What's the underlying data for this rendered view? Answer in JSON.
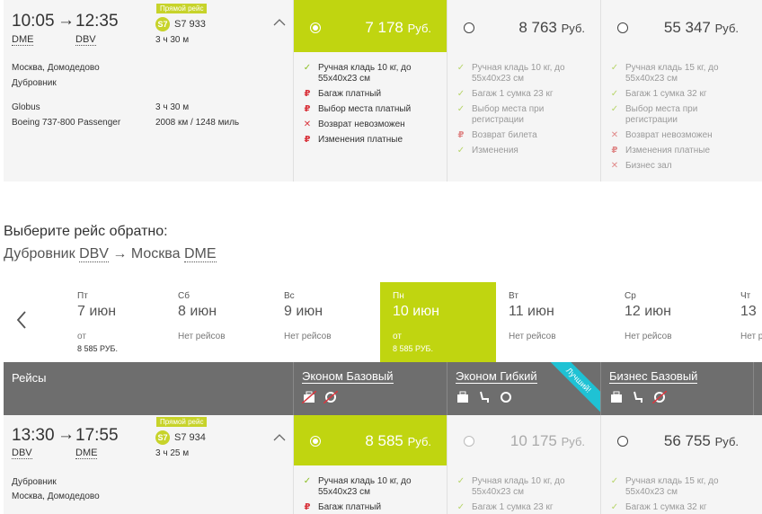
{
  "outbound": {
    "dep_time": "10:05",
    "arr_time": "12:35",
    "dep_code": "DME",
    "arr_code": "DBV",
    "direct_label": "Прямой рейс",
    "carrier_logo": "S7",
    "flight_no": "S7 933",
    "duration": "3 ч 30 м",
    "origin": "Москва, Домодедово",
    "destination": "Дубровник",
    "operator": "Globus",
    "aircraft": "Boeing 737-800 Passenger",
    "duration2": "3 ч 30 м",
    "distance": "2008 км / 1248 миль",
    "fares": [
      {
        "amount": "7 178",
        "currency": "Руб.",
        "selected": true,
        "features": [
          {
            "icon": "ok",
            "text": "Ручная кладь 10 кг, до 55x40x23 см"
          },
          {
            "icon": "rub",
            "text": "Багаж платный"
          },
          {
            "icon": "rub",
            "text": "Выбор места платный"
          },
          {
            "icon": "no",
            "text": "Возврат невозможен"
          },
          {
            "icon": "rub",
            "text": "Изменения платные"
          }
        ]
      },
      {
        "amount": "8 763",
        "currency": "Руб.",
        "selected": false,
        "features": [
          {
            "icon": "ok",
            "text": "Ручная кладь 10 кг, до 55x40x23 см"
          },
          {
            "icon": "ok",
            "text": "Багаж 1 сумка 23 кг"
          },
          {
            "icon": "ok",
            "text": "Выбор места при регистрации"
          },
          {
            "icon": "rub",
            "text": "Возврат билета"
          },
          {
            "icon": "ok",
            "text": "Изменения"
          }
        ]
      },
      {
        "amount": "55 347",
        "currency": "Руб.",
        "selected": false,
        "features": [
          {
            "icon": "ok",
            "text": "Ручная кладь 15 кг, до 55x40x23 см"
          },
          {
            "icon": "ok",
            "text": "Багаж 1 сумка 32 кг"
          },
          {
            "icon": "ok",
            "text": "Выбор места при регистрации"
          },
          {
            "icon": "no",
            "text": "Возврат невозможен"
          },
          {
            "icon": "rub",
            "text": "Изменения платные"
          },
          {
            "icon": "no",
            "text": "Бизнес зал"
          }
        ]
      }
    ]
  },
  "return_heading": {
    "title": "Выберите рейс обратно:",
    "from_city": "Дубровник",
    "from_code": "DBV",
    "arrow": "→",
    "to_city": "Москва",
    "to_code": "DME"
  },
  "calendar": {
    "prev_icon": "chevron-left",
    "days": [
      {
        "dow": "Пт",
        "date": "7 июн",
        "status": "от",
        "price": "8 585 РУБ."
      },
      {
        "dow": "Сб",
        "date": "8 июн",
        "status": "Нет рейсов",
        "price": ""
      },
      {
        "dow": "Вс",
        "date": "9 июн",
        "status": "Нет рейсов",
        "price": ""
      },
      {
        "dow": "Пн",
        "date": "10 июн",
        "status": "от",
        "price": "8 585 РУБ."
      },
      {
        "dow": "Вт",
        "date": "11 июн",
        "status": "Нет рейсов",
        "price": ""
      },
      {
        "dow": "Ср",
        "date": "12 июн",
        "status": "Нет рейсов",
        "price": ""
      },
      {
        "dow": "Чт",
        "date": "13",
        "status": "Нет р",
        "price": ""
      }
    ]
  },
  "table_header": {
    "flights_label": "Рейсы",
    "fares": [
      {
        "label": "Эконом Базовый",
        "icons": [
          "baggage-crossed-icon",
          "exchange-crossed-icon"
        ]
      },
      {
        "label": "Эконом Гибкий",
        "icons": [
          "baggage-icon",
          "seat-icon",
          "exchange-icon"
        ],
        "ribbon": "Лучший!"
      },
      {
        "label": "Бизнес Базовый",
        "icons": [
          "baggage-icon",
          "seat-icon",
          "exchange-crossed-icon"
        ]
      }
    ]
  },
  "return_flight": {
    "dep_time": "13:30",
    "arr_time": "17:55",
    "dep_code": "DBV",
    "arr_code": "DME",
    "direct_label": "Прямой рейс",
    "carrier_logo": "S7",
    "flight_no": "S7 934",
    "duration": "3 ч 25 м",
    "origin": "Дубровник",
    "destination": "Москва, Домодедово",
    "fares": [
      {
        "amount": "8 585",
        "currency": "Руб.",
        "selected": true,
        "features": [
          {
            "icon": "ok",
            "text": "Ручная кладь 10 кг, до 55x40x23 см"
          },
          {
            "icon": "rub",
            "text": "Багаж платный"
          }
        ]
      },
      {
        "amount": "10 175",
        "currency": "Руб.",
        "selected": false,
        "features": [
          {
            "icon": "ok",
            "text": "Ручная кладь 10 кг, до 55x40x23 см"
          },
          {
            "icon": "ok",
            "text": "Багаж 1 сумка 23 кг"
          }
        ]
      },
      {
        "amount": "56 755",
        "currency": "Руб.",
        "selected": false,
        "features": [
          {
            "icon": "ok",
            "text": "Ручная кладь 15 кг, до 55x40x23 см"
          },
          {
            "icon": "ok",
            "text": "Багаж 1 сумка 32 кг"
          }
        ]
      }
    ]
  }
}
